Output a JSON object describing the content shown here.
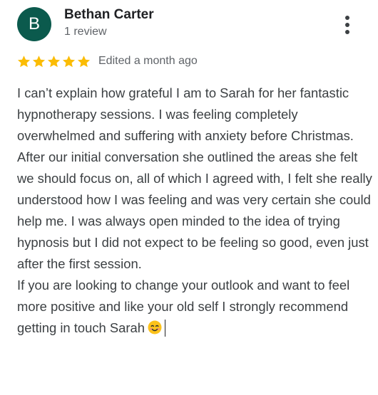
{
  "reviewer": {
    "avatar_initial": "B",
    "avatar_color": "#0b5a4d",
    "name": "Bethan Carter",
    "review_count": "1 review"
  },
  "menu": {
    "icon": "more-vert-icon"
  },
  "rating": {
    "stars": 5,
    "max_stars": 5,
    "star_color": "#fbbc04",
    "edited_label": "Edited a month ago"
  },
  "review": {
    "paragraphs": [
      "I can’t explain how grateful I am to Sarah for her fantastic hypnotherapy sessions. I was feeling completely overwhelmed and suffering with anxiety before Christmas.",
      "After our initial conversation she outlined the areas she felt we should focus on, all of which I agreed with, I felt she really understood how I was feeling and was very certain she could help me. I was always open minded to the idea of trying hypnosis but I did not expect to be feeling so good, even just after the first session.",
      "If you are looking to change your outlook and want to feel more positive and like your old self I strongly recommend getting in touch Sarah"
    ],
    "trailing_emoji": "smiling-face-icon"
  }
}
